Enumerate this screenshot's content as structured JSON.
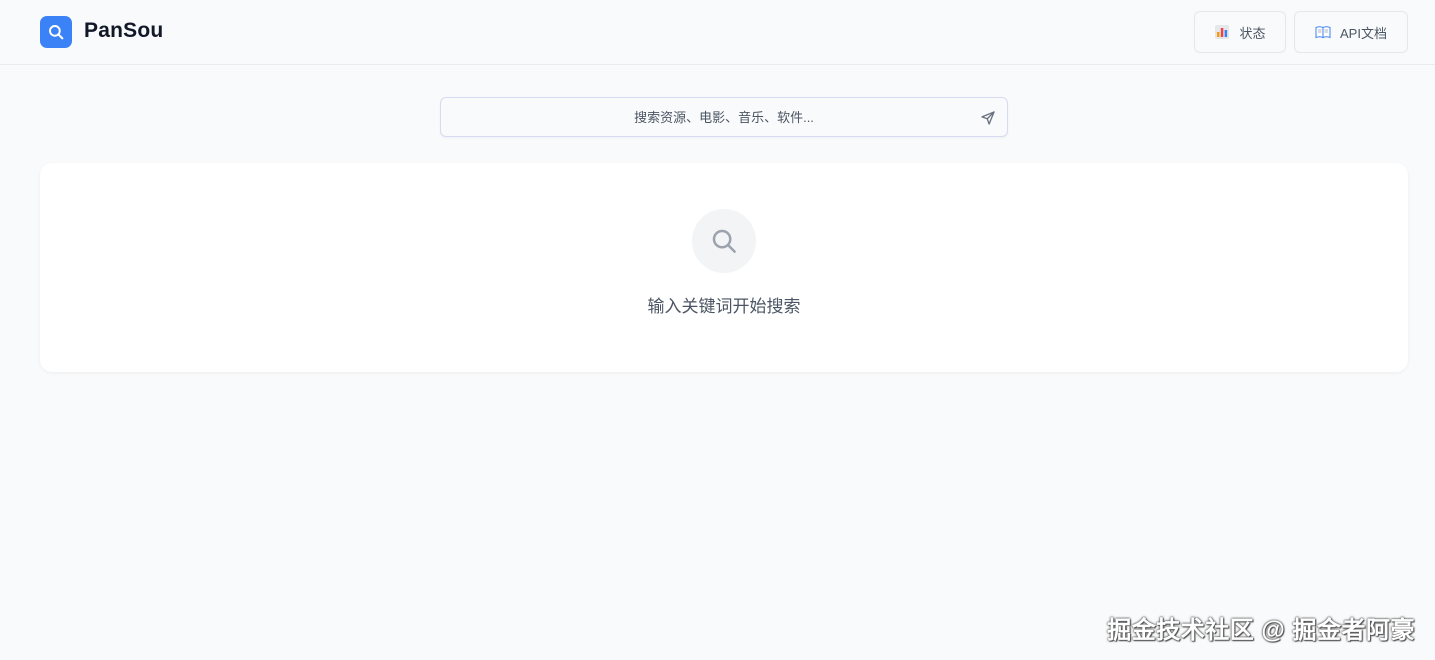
{
  "header": {
    "app_title": "PanSou",
    "logo_icon": "search-icon",
    "buttons": [
      {
        "label": "状态",
        "icon": "bar-chart-icon"
      },
      {
        "label": "API文档",
        "icon": "book-icon"
      }
    ]
  },
  "search": {
    "placeholder": "搜索资源、电影、音乐、软件...",
    "value": "",
    "submit_icon": "send-icon"
  },
  "empty_state": {
    "icon": "search-icon",
    "message": "输入关键词开始搜索"
  },
  "watermark": "掘金技术社区 @ 掘金者阿豪",
  "colors": {
    "accent": "#3b82f6",
    "background": "#f9fafb",
    "card": "#ffffff"
  }
}
